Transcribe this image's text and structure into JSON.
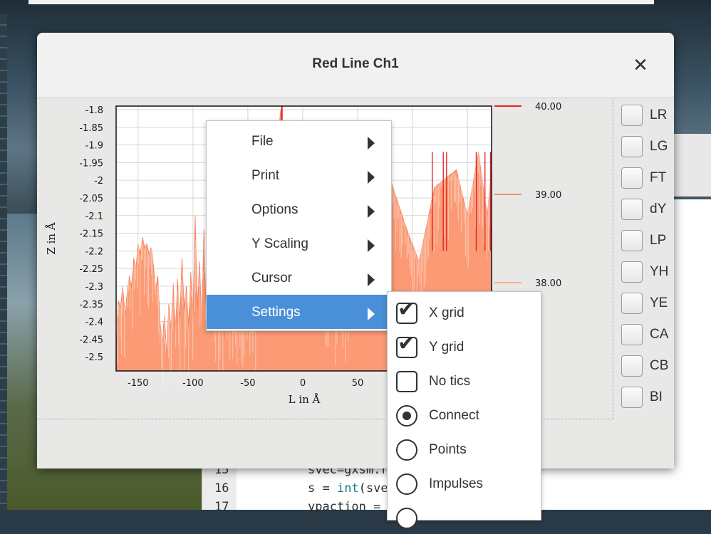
{
  "dialog": {
    "title": "Red Line Ch1",
    "close_glyph": "✕"
  },
  "toggles": [
    "LR",
    "LG",
    "FT",
    "dY",
    "LP",
    "YH",
    "YE",
    "CA",
    "CB",
    "BI"
  ],
  "menu": {
    "items": [
      {
        "label": "File"
      },
      {
        "label": "Print"
      },
      {
        "label": "Options"
      },
      {
        "label": "Y Scaling"
      },
      {
        "label": "Cursor"
      },
      {
        "label": "Settings",
        "active": true
      }
    ]
  },
  "submenu": {
    "items": [
      {
        "label": "X grid",
        "kind": "check",
        "checked": true
      },
      {
        "label": "Y grid",
        "kind": "check",
        "checked": true
      },
      {
        "label": "No tics",
        "kind": "check",
        "checked": false
      },
      {
        "label": "Connect",
        "kind": "radio",
        "checked": true
      },
      {
        "label": "Points",
        "kind": "radio",
        "checked": false
      },
      {
        "label": "Impulses",
        "kind": "radio",
        "checked": false
      }
    ]
  },
  "editor": {
    "lines": [
      {
        "num": "15",
        "text": "svec=gxsm.r"
      },
      {
        "num": "16",
        "pre": "s = ",
        "fn": "int",
        "post": "(svec["
      },
      {
        "num": "17",
        "text": "ypaction = s"
      }
    ]
  },
  "chart_data": {
    "type": "area",
    "xlabel": "L in Å",
    "ylabel": "Z in Å",
    "x_ticks": [
      "-150",
      "-100",
      "-50",
      "0",
      "50"
    ],
    "x_tick_values": [
      -150,
      -100,
      -50,
      0,
      50
    ],
    "y_ticks": [
      "-1.8",
      "-1.85",
      "-1.9",
      "-1.95",
      "-2",
      "-2.05",
      "-2.1",
      "-2.15",
      "-2.2",
      "-2.25",
      "-2.3",
      "-2.35",
      "-2.4",
      "-2.45",
      "-2.5"
    ],
    "y_tick_values": [
      -1.8,
      -1.85,
      -1.9,
      -1.95,
      -2,
      -2.05,
      -2.1,
      -2.15,
      -2.2,
      -2.25,
      -2.3,
      -2.35,
      -2.4,
      -2.45,
      -2.5
    ],
    "xlim": [
      -170,
      172
    ],
    "ylim": [
      -2.54,
      -1.79
    ],
    "grid": true,
    "series_colors": {
      "fill": "#fb9a74",
      "peak": "#e41a1c"
    },
    "legend": [
      {
        "label": "40.00",
        "color": "#e8201c"
      },
      {
        "label": "39.00",
        "color": "#f58f70"
      },
      {
        "label": "38.00",
        "color": "#fbb090"
      }
    ],
    "profile": [
      [
        -170,
        -2.49
      ],
      [
        -168,
        -2.34
      ],
      [
        -166,
        -2.36
      ],
      [
        -164,
        -2.3
      ],
      [
        -162,
        -2.38
      ],
      [
        -160,
        -2.32
      ],
      [
        -158,
        -2.27
      ],
      [
        -156,
        -2.3
      ],
      [
        -154,
        -2.22
      ],
      [
        -152,
        -2.25
      ],
      [
        -150,
        -2.18
      ],
      [
        -148,
        -2.21
      ],
      [
        -146,
        -2.16
      ],
      [
        -144,
        -2.19
      ],
      [
        -142,
        -2.18
      ],
      [
        -140,
        -2.21
      ],
      [
        -138,
        -2.19
      ],
      [
        -136,
        -2.24
      ],
      [
        -134,
        -2.31
      ],
      [
        -132,
        -2.27
      ],
      [
        -130,
        -2.4
      ],
      [
        -128,
        -2.46
      ],
      [
        -126,
        -2.38
      ],
      [
        -124,
        -2.49
      ],
      [
        -122,
        -2.35
      ],
      [
        -120,
        -2.42
      ],
      [
        -118,
        -2.29
      ],
      [
        -116,
        -2.43
      ],
      [
        -114,
        -2.28
      ],
      [
        -112,
        -2.4
      ],
      [
        -110,
        -2.22
      ],
      [
        -108,
        -2.36
      ],
      [
        -106,
        -2.3
      ],
      [
        -104,
        -2.41
      ],
      [
        -102,
        -2.26
      ],
      [
        -100,
        -2.39
      ],
      [
        -98,
        -2.1
      ],
      [
        -96,
        -2.36
      ],
      [
        -94,
        -2.23
      ],
      [
        -92,
        -2.4
      ],
      [
        -90,
        -2.14
      ],
      [
        -88,
        -2.38
      ],
      [
        -86,
        -2.22
      ],
      [
        -84,
        -2.43
      ],
      [
        -82,
        -2.25
      ],
      [
        -80,
        -2.44
      ],
      [
        -78,
        -2.26
      ],
      [
        -76,
        -2.43
      ],
      [
        -74,
        -2.3
      ],
      [
        -72,
        -2.44
      ],
      [
        -70,
        -2.34
      ],
      [
        -40,
        -2.36
      ],
      [
        -20,
        -1.8
      ],
      [
        -18,
        -2.1
      ],
      [
        40,
        -2.4
      ],
      [
        60,
        -2.03
      ],
      [
        80,
        -2.0
      ],
      [
        96,
        -2.15
      ],
      [
        106,
        -2.23
      ],
      [
        120,
        -2.02
      ],
      [
        140,
        -1.97
      ],
      [
        150,
        -2.1
      ],
      [
        160,
        -1.92
      ],
      [
        168,
        -2.1
      ],
      [
        172,
        -1.97
      ]
    ]
  }
}
